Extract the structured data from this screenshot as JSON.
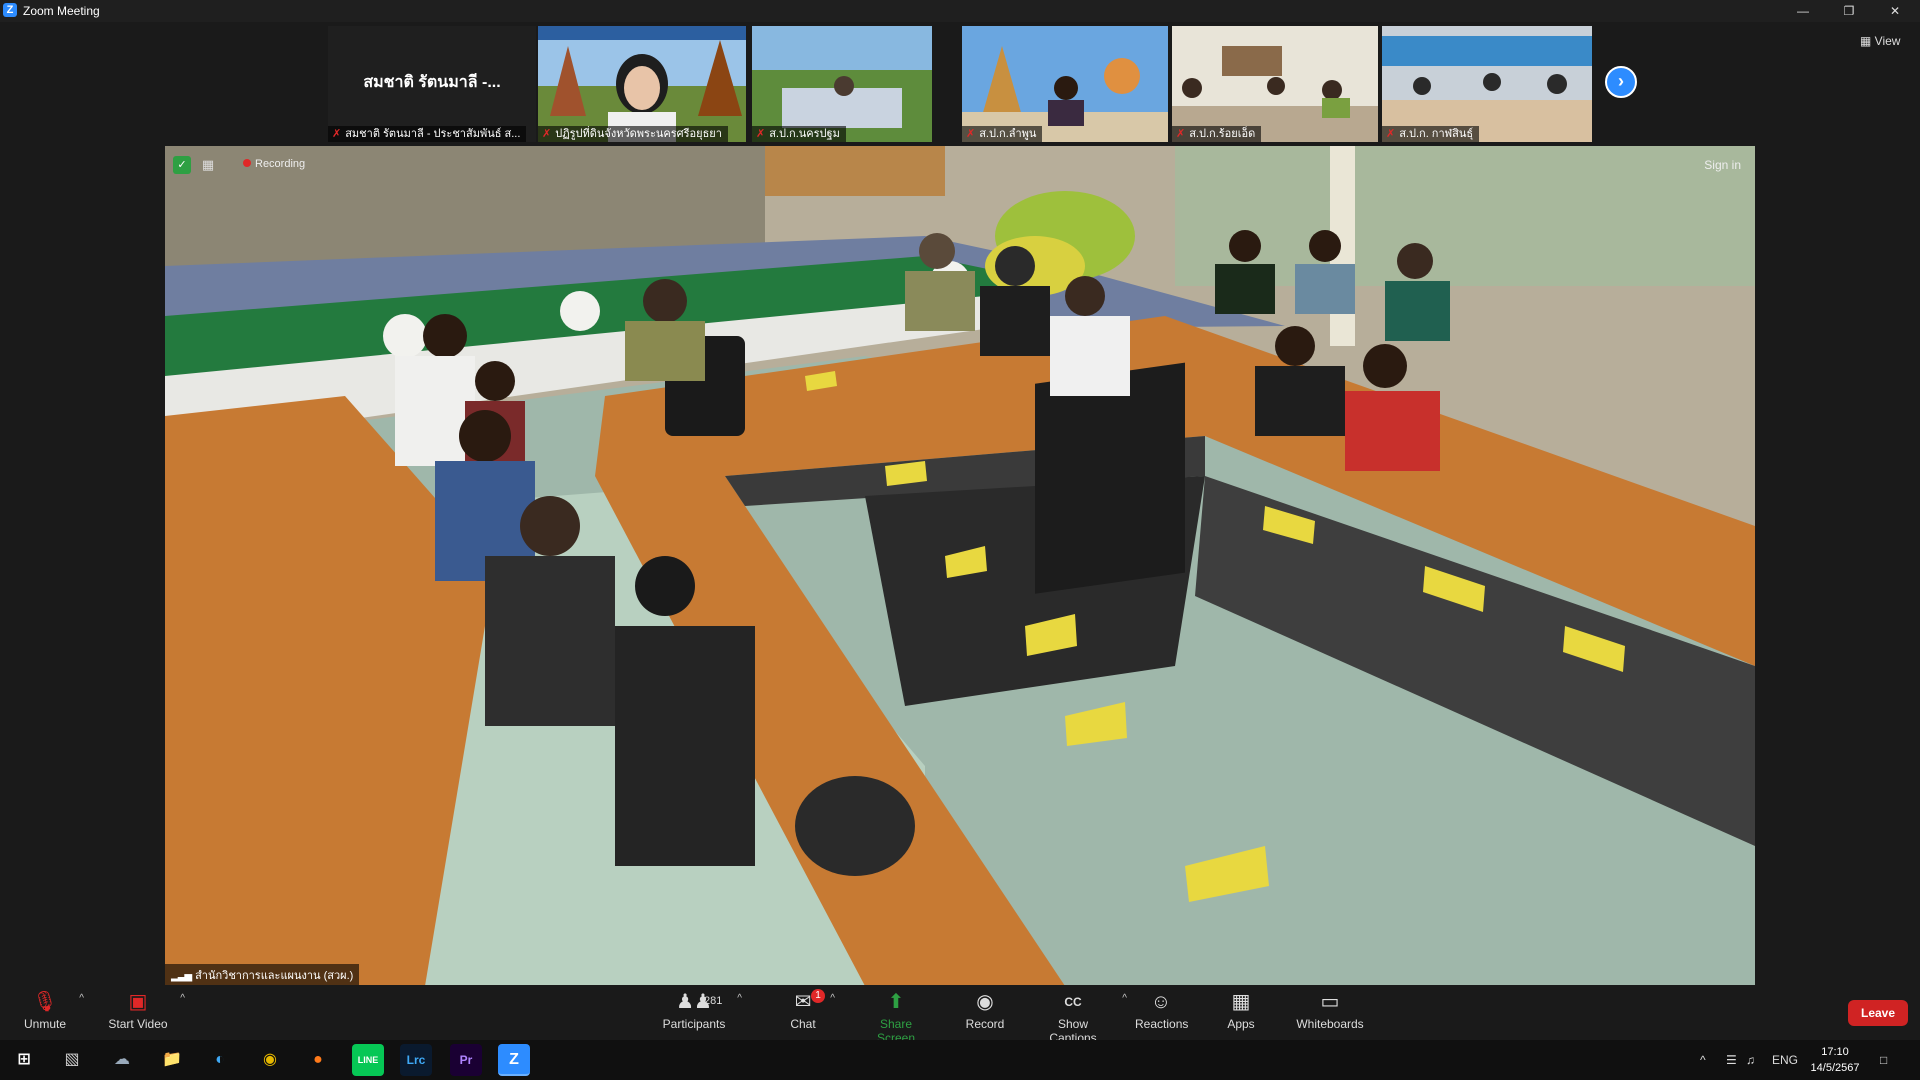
{
  "window": {
    "title": "Zoom Meeting",
    "controls": [
      "minimize-icon",
      "restore-icon",
      "close-icon"
    ]
  },
  "gallery": {
    "tiles": [
      {
        "center_name": "สมชาติ รัตนมาลี -...",
        "label": "สมชาติ รัตนมาลี - ประชาสัมพันธ์ ส..."
      },
      {
        "label": "ปฏิรูปที่ดินจังหวัดพระนครศรีอยุธยา"
      },
      {
        "label": "ส.ป.ก.นครปฐม"
      },
      {
        "label": "ส.ป.ก.ลำพูน"
      },
      {
        "label": "ส.ป.ก.ร้อยเอ็ด"
      },
      {
        "label": "ส.ป.ก. กาฬสินธุ์"
      }
    ],
    "view_label": "View"
  },
  "main_video": {
    "recording_label": "Recording",
    "sign_in": "Sign in",
    "speaker": "สำนักวิชาการและแผนงาน (สวผ.)"
  },
  "toolbar": {
    "unmute": "Unmute",
    "start_video": "Start Video",
    "participants": "Participants",
    "participants_count": "281",
    "chat": "Chat",
    "chat_badge": "1",
    "share_screen": "Share Screen",
    "record": "Record",
    "show_captions": "Show Captions",
    "reactions": "Reactions",
    "apps": "Apps",
    "whiteboards": "Whiteboards",
    "leave": "Leave",
    "cc_glyph": "CC"
  },
  "taskbar": {
    "lang": "ENG",
    "time": "17:10",
    "date": "14/5/2567",
    "apps": [
      "windows-start",
      "task-view",
      "explorer-photo",
      "file-explorer",
      "edge",
      "chrome",
      "firefox",
      "line",
      "lightroom-classic",
      "premiere-pro",
      "zoom"
    ],
    "app_labels": {
      "lrc": "Lrc",
      "pr": "Pr",
      "line": "LINE",
      "zoom": "Z"
    }
  },
  "colors": {
    "zoom_blue": "#2D8CFF",
    "leave_red": "#d02323",
    "share_green": "#2ea043",
    "muted_red": "#e02828"
  }
}
